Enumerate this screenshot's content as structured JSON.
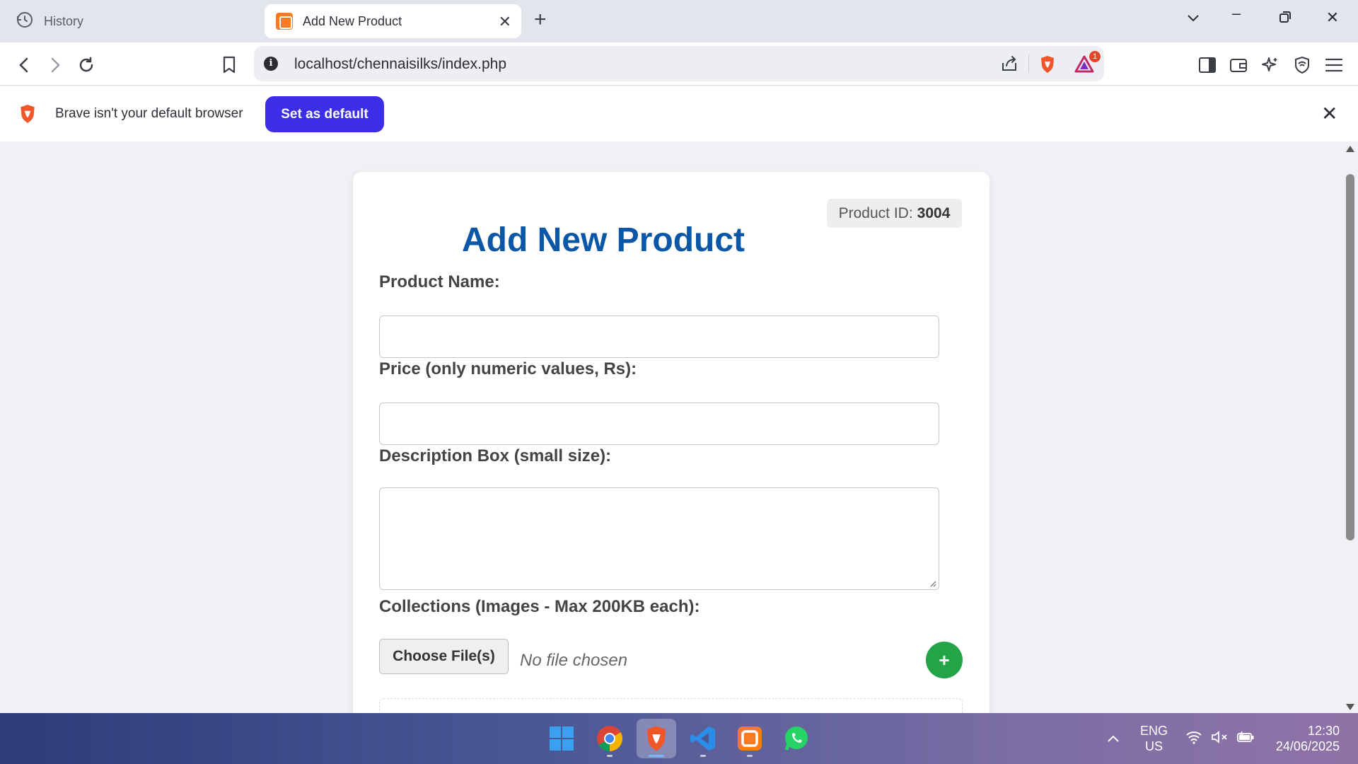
{
  "tabs": {
    "inactive_label": "History",
    "active_label": "Add New Product"
  },
  "toolbar": {
    "url": "localhost/chennaisilks/index.php",
    "rewards_badge": "1"
  },
  "infobar": {
    "message": "Brave isn't your default browser",
    "button_label": "Set as default"
  },
  "form": {
    "product_id_label": "Product ID:",
    "product_id_value": "3004",
    "title": "Add New Product",
    "name_label": "Product Name:",
    "price_label": "Price (only numeric values, Rs):",
    "description_label": "Description Box (small size):",
    "collections_label": "Collections (Images - Max 200KB each):",
    "choose_button": "Choose File(s)",
    "no_file_text": "No file chosen",
    "add_button": "+"
  },
  "taskbar": {
    "lang_top": "ENG",
    "lang_bottom": "US",
    "time": "12:30",
    "date": "24/06/2025"
  },
  "colors": {
    "title_blue": "#0a57a8",
    "brave_button": "#3c2ee8",
    "add_green": "#22a447",
    "xampp_orange": "#fb7a24"
  },
  "icons": [
    "history-icon",
    "xampp-favicon",
    "close-icon",
    "plus-icon",
    "chevron-down-icon",
    "minimize-icon",
    "restore-icon",
    "back-icon",
    "forward-icon",
    "reload-icon",
    "bookmark-icon",
    "info-icon",
    "share-icon",
    "brave-shield-icon",
    "brave-rewards-icon",
    "sidebar-icon",
    "wallet-icon",
    "leo-ai-icon",
    "vpn-icon",
    "menu-icon",
    "windows-start-icon",
    "chrome-icon",
    "brave-icon",
    "vscode-icon",
    "xampp-icon",
    "whatsapp-icon",
    "chevron-up-icon",
    "wifi-icon",
    "speaker-muted-icon",
    "battery-icon"
  ]
}
